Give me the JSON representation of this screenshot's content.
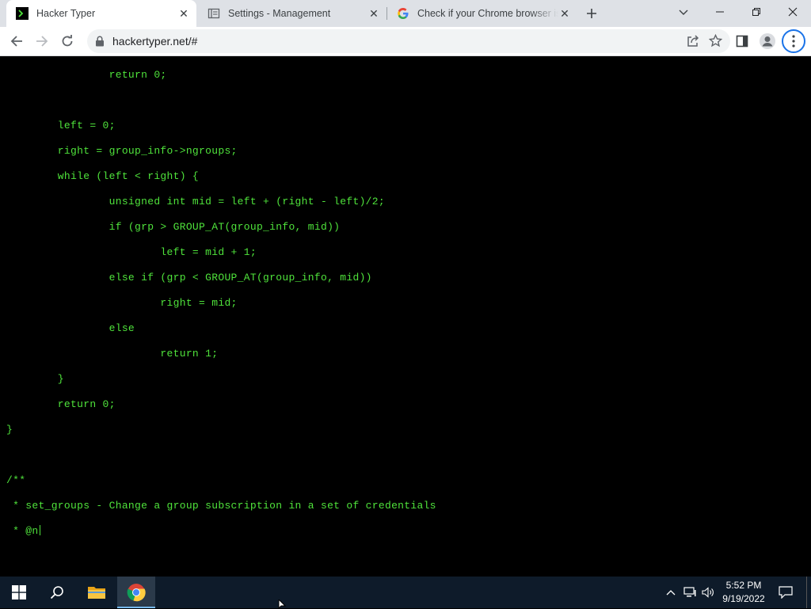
{
  "browser": {
    "tabs": [
      {
        "title": "Hacker Typer",
        "favicon": "hackertyper-icon",
        "active": true
      },
      {
        "title": "Settings - Management",
        "favicon": "settings-page-icon",
        "active": false
      },
      {
        "title": "Check if your Chrome browser is",
        "favicon": "google-g-icon",
        "active": false
      }
    ],
    "address_bar": {
      "url": "hackertyper.net/#"
    }
  },
  "terminal": {
    "text_color": "#4fe33b",
    "lines": [
      "\t\treturn 0;",
      "",
      "\tleft = 0;",
      "\tright = group_info->ngroups;",
      "\twhile (left < right) {",
      "\t\tunsigned int mid = left + (right - left)/2;",
      "\t\tif (grp > GROUP_AT(group_info, mid))",
      "\t\t\tleft = mid + 1;",
      "\t\telse if (grp < GROUP_AT(group_info, mid))",
      "\t\t\tright = mid;",
      "\t\telse",
      "\t\t\treturn 1;",
      "\t}",
      "\treturn 0;",
      "}",
      "",
      "/**",
      " * set_groups - Change a group subscription in a set of credentials",
      " * @n"
    ]
  },
  "taskbar": {
    "items": [
      "start-button",
      "search-button",
      "file-explorer",
      "chrome"
    ],
    "clock": {
      "time": "5:52 PM",
      "date": "9/19/2022"
    }
  }
}
